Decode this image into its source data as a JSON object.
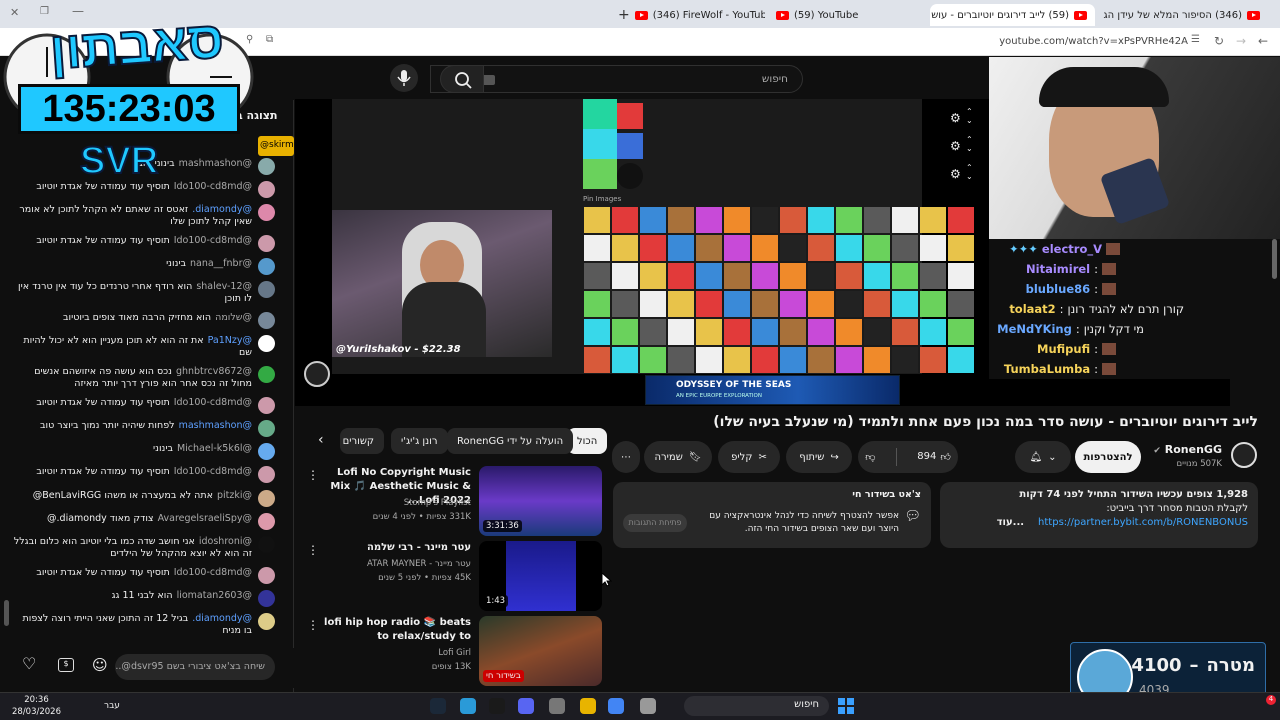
{
  "browser": {
    "tabs": [
      {
        "title": "(346) הסיפור המלא של עידן הג"
      },
      {
        "title": "(59) לייב דירוגים יוטיוברים - עוש"
      },
      {
        "title": "(59) YouTube"
      },
      {
        "title": "(346) FireWolf - YouTube"
      }
    ],
    "url": "youtube.com/watch?v=xPsPVRHe42A"
  },
  "masthead": {
    "search_placeholder": "חיפוש"
  },
  "overlay": {
    "logo": "סאבתון",
    "timer": "135:23:03",
    "tag": "SVR"
  },
  "chat": {
    "header_label": "תצוגה ב",
    "pinned_name": "@skirm15",
    "messages": [
      {
        "name": "@mashmashon",
        "text": "בינוני טוב"
      },
      {
        "name": "@Ido100-cd8md",
        "text": "תוסיף עוד עמודה של אגדת יוטיוב"
      },
      {
        "name": "@diamondy.",
        "text": "זאטס זה שאתם לא הקהל לתוכן לא אומר שאין קהל לתוכן שלו",
        "hl": true
      },
      {
        "name": "@Ido100-cd8md",
        "text": "תוסיף עוד עמודה של אגדת יוטיוב"
      },
      {
        "name": "@nana__fnbr",
        "text": "בינוני"
      },
      {
        "name": "@shalev-12",
        "text": "הוא רודף אחרי טרנדים כל עוד אין טרנד אין לו תוכן"
      },
      {
        "name": "@שלומה",
        "text": "הוא מחזיק הרבה מאוד צופים ביוטיוב"
      },
      {
        "name": "@Pa1Nzy",
        "text": "את זה הוא לא תוכן מעניין הוא לא יכול להיות שם",
        "hl": true
      },
      {
        "name": "@ghnbtrcv8672",
        "text": "נכס הוא עושה פה איזושהם אנשים מחול זה נכס אחר הוא פורץ דרך יותר מאיזה"
      },
      {
        "name": "@Ido100-cd8md",
        "text": "תוסיף עוד עמודה של אגדת יוטיוב"
      },
      {
        "name": "@mashmashon",
        "text": "לפחות שיהיה יותר נמוך ביוצר טוב",
        "hl": true
      },
      {
        "name": "@Michael-k5k6l",
        "text": "בינוני"
      },
      {
        "name": "@Ido100-cd8md",
        "text": "תוסיף עוד עמודה של אגדת יוטיוב"
      },
      {
        "name": "@pitzki",
        "text": "אתה לא במעצרה או משהו BenLaviRGG@"
      },
      {
        "name": "@AvaregelsraeliSpy",
        "text": "צודק מאוד diamondy.@"
      },
      {
        "name": "@idoshroni",
        "text": "אני חושב שדה כמו בלי יוטיוב הוא כלום ובגלל זה הוא לא יוצא מהקהל של הילדים"
      },
      {
        "name": "@Ido100-cd8md",
        "text": "תוסיף עוד עמודה של אגדת יוטיוב"
      },
      {
        "name": "@liomatan2603",
        "text": "הוא לבני 11 גג"
      },
      {
        "name": "@diamondy.",
        "text": "בגיל 12 זה התוכן שאני הייתי רוצה לצפות בו מניח",
        "hl": true
      }
    ],
    "input_placeholder": "שיחה בצ'אט ציבורי בשם dsvr95@..."
  },
  "stream": {
    "cam_label": "@YuriIshakov - $22.38",
    "pin_label": "Pin Images",
    "ad_text": "ODYSSEY OF THE SEAS",
    "ad_sub": "AN EPIC EUROPE EXPLORATION"
  },
  "cam_chat": [
    {
      "name": "electro_V",
      "text": ""
    },
    {
      "name": "Nitaimirel",
      "text": ""
    },
    {
      "name": "blublue86",
      "text": ""
    },
    {
      "name": "tolaat2",
      "text": "קורן תרם לא להגיד רונן"
    },
    {
      "name": "MeNdYKing",
      "text": "מי דקל וקנין"
    },
    {
      "name": "Mufipufi",
      "text": ""
    },
    {
      "name": "TumbaLumba",
      "text": ""
    }
  ],
  "video_info": {
    "title": "לייב דירוגים יוטיוברים - עושה סדר במה נכון פעם אחת ולתמיד (מי שנעלב בעיה שלו)",
    "channel": "RonenGG",
    "subs": "507K מנויים",
    "subscribe": "להצטרפות",
    "likes": "894",
    "share": "שיתוף",
    "clip": "קליפ",
    "save": "שמירה"
  },
  "description": {
    "line1": "1,928 צופים עכשיו  השידור התחיל לפני 74 דקות",
    "line2": "לקבלת הטבות מסחר דרך בייביט:",
    "link": "https://partner.bybit.com/b/RONENBONUS",
    "more": "...עוד"
  },
  "chat_card": {
    "title": "צ'אט בשידור חי",
    "text": "אפשר להצטרף לשיחה כדי לנהל אינטראקציה עם היוצר ועם שאר הצופים בשידור החי הזה.",
    "button": "פתיחת התגובות"
  },
  "chips": [
    "הכול",
    "הועלה על ידי RonenGG",
    "רונן ג'יג'י",
    "קשורים"
  ],
  "recs": [
    {
      "title": "Lofi No Copyright Music Mix 🎵 Aesthetic Music & Lofi 2022...",
      "channel": "Stomp's Playlist",
      "meta": "331K צפיות • לפני 4 שנים",
      "duration": "3:31:36"
    },
    {
      "title": "עטר מיינר - רבי שלמה",
      "channel": "עטר מיינר - ATAR MAYNER",
      "meta": "45K צפיות • לפני 5 שנים",
      "duration": "1:43"
    },
    {
      "title": "lofi hip hop radio 📚 beats to relax/study to",
      "channel": "Lofi Girl",
      "meta": "13K צופים",
      "duration": "בשידור חי"
    }
  ],
  "goal": {
    "label": "מטרה",
    "target": "4100",
    "current": "4039"
  },
  "taskbar": {
    "search": "חיפוש",
    "time": "20:36",
    "date": "28/03/2026",
    "lang": "עבר"
  }
}
